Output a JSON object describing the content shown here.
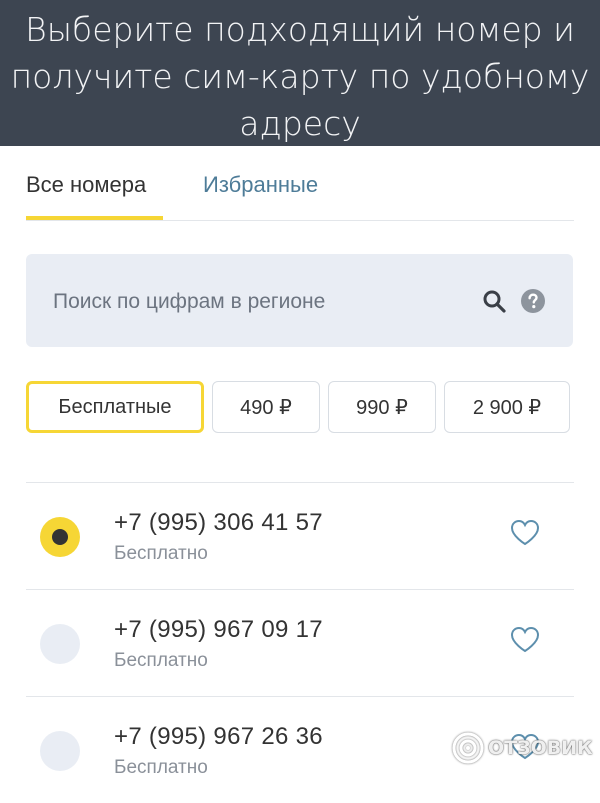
{
  "banner": {
    "line1": "Выберите подходящий номер и",
    "line2": "получите сим-карту по удобному",
    "line3": "адресу"
  },
  "tabs": [
    {
      "label": "Все номера",
      "active": true
    },
    {
      "label": "Избранные",
      "active": false
    }
  ],
  "search": {
    "placeholder": "Поиск по цифрам в регионе",
    "search_icon": "search-icon",
    "help_icon": "help-icon"
  },
  "price_filters": [
    {
      "label": "Бесплатные",
      "active": true
    },
    {
      "label": "490 ₽",
      "active": false
    },
    {
      "label": "990 ₽",
      "active": false
    },
    {
      "label": "2 900 ₽",
      "active": false
    }
  ],
  "numbers": [
    {
      "phone": "+7 (995) 306 41 57",
      "price": "Бесплатно",
      "selected": true
    },
    {
      "phone": "+7 (995) 967 09 17",
      "price": "Бесплатно",
      "selected": false
    },
    {
      "phone": "+7 (995) 967 26 36",
      "price": "Бесплатно",
      "selected": false
    }
  ],
  "watermark": {
    "text": "ОТЗОВИК"
  },
  "colors": {
    "banner_bg": "#3d4551",
    "accent_yellow": "#f6d635",
    "link_blue": "#4e7c98",
    "search_bg": "#e9edf4"
  }
}
